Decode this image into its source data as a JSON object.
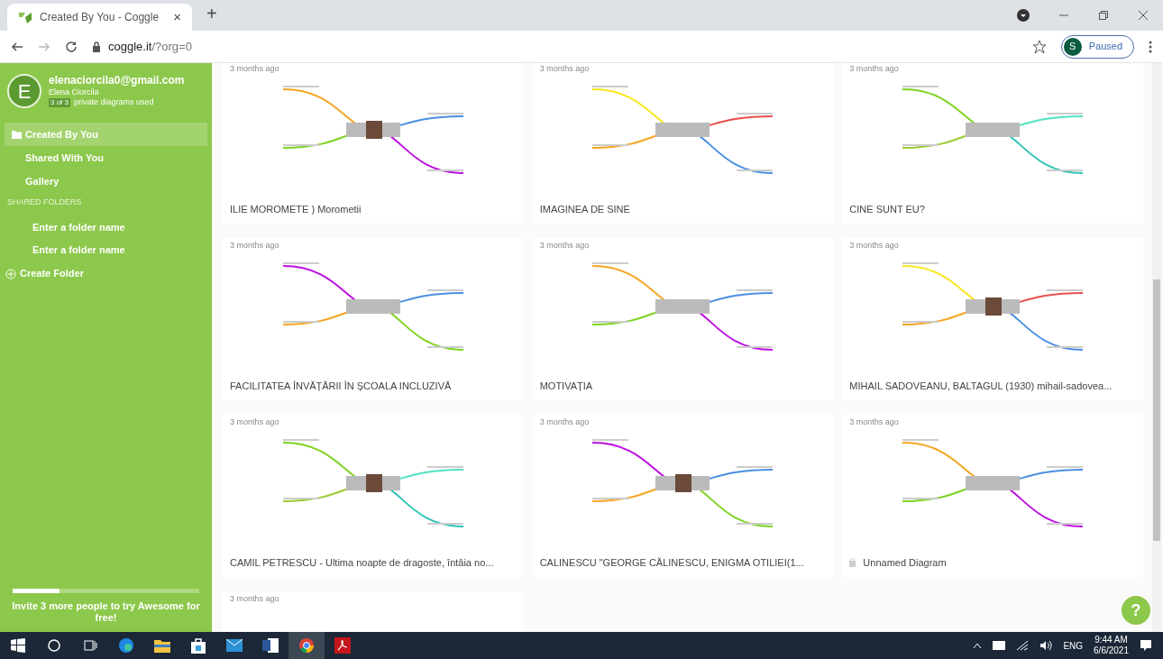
{
  "browser": {
    "tab_title": "Created By You - Coggle",
    "tab_close": "×",
    "new_tab": "+",
    "url_host": "coggle.it",
    "url_path": "/?org=0",
    "profile_initial": "S",
    "profile_status": "Paused"
  },
  "sidebar": {
    "avatar_letter": "E",
    "email": "elenaciorcila0@gmail.com",
    "user_name": "Elena Ciorcila",
    "usage_badge": "3 of 3",
    "usage_text": "private diagrams used",
    "items": [
      {
        "label": "Created By You",
        "selected": true,
        "kind": "folder"
      },
      {
        "label": "Shared With You",
        "selected": false,
        "kind": "plain"
      },
      {
        "label": "Gallery",
        "selected": false,
        "kind": "plain"
      }
    ],
    "section_heading": "SHARED FOLDERS",
    "folders": [
      {
        "label": "Enter a folder name"
      },
      {
        "label": "Enter a folder name"
      }
    ],
    "create_folder": "Create Folder",
    "invite_progress": {
      "level": 0.25
    },
    "invite_text": "Invite 3 more people to try Awesome for free!"
  },
  "diagrams": [
    {
      "age": "3 months ago",
      "title": "ILIE MOROMETE ) Morometii",
      "private": false,
      "photo": true
    },
    {
      "age": "3 months ago",
      "title": "IMAGINEA DE SINE",
      "private": false,
      "photo": false
    },
    {
      "age": "3 months ago",
      "title": "CINE SUNT EU?",
      "private": false,
      "photo": false
    },
    {
      "age": "3 months ago",
      "title": "FACILITATEA ÎNVĂȚĂRII ÎN ȘCOALA INCLUZIVĂ",
      "private": false,
      "photo": false
    },
    {
      "age": "3 months ago",
      "title": "MOTIVAȚIA",
      "private": false,
      "photo": false
    },
    {
      "age": "3 months ago",
      "title": "MIHAIL SADOVEANU, BALTAGUL (1930) mihail-sadovea...",
      "private": false,
      "photo": true
    },
    {
      "age": "3 months ago",
      "title": "CAMIL PETRESCU - Ultima noapte de dragoste, întâia no...",
      "private": false,
      "photo": true
    },
    {
      "age": "3 months ago",
      "title": "CALINESCU \"GEORGE CĂLINESCU, ENIGMA OTILIEI(1...",
      "private": false,
      "photo": true
    },
    {
      "age": "3 months ago",
      "title": "Unnamed Diagram",
      "private": true,
      "photo": false
    },
    {
      "age": "3 months ago",
      "partial": true
    }
  ],
  "help_button": "?",
  "taskbar": {
    "language": "ENG",
    "time": "9:44 AM",
    "date": "6/6/2021"
  }
}
